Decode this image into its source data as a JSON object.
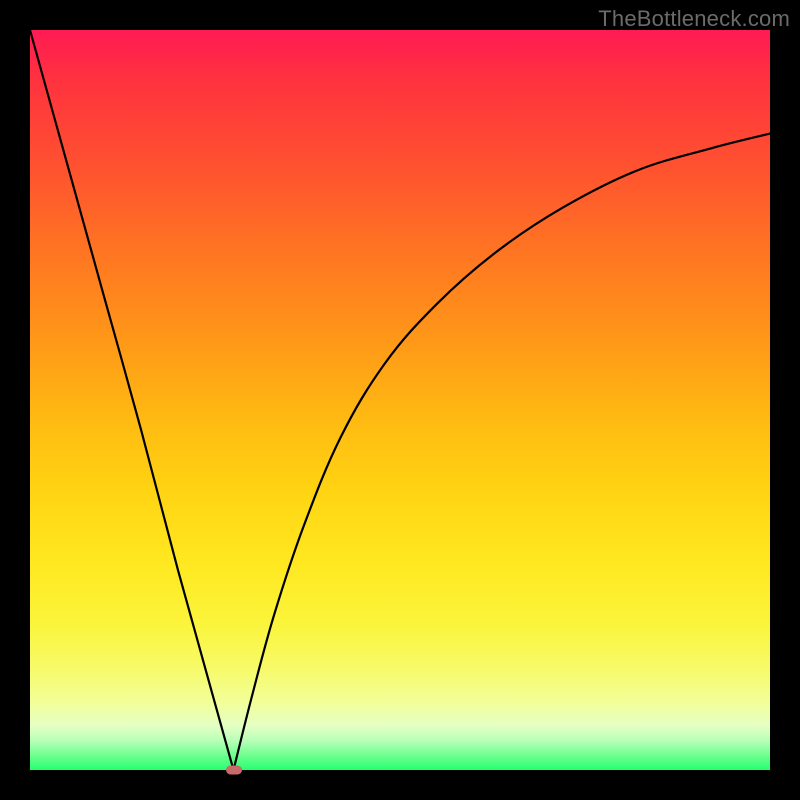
{
  "watermark": "TheBottleneck.com",
  "chart_data": {
    "type": "line",
    "title": "",
    "xlabel": "",
    "ylabel": "",
    "xlim": [
      0,
      100
    ],
    "ylim": [
      0,
      100
    ],
    "grid": false,
    "legend": false,
    "series": [
      {
        "name": "left-branch",
        "x": [
          0,
          5,
          10,
          15,
          20,
          25,
          27.5
        ],
        "values": [
          100,
          82,
          64,
          46,
          27,
          9,
          0
        ]
      },
      {
        "name": "right-branch",
        "x": [
          27.5,
          30,
          33,
          37,
          42,
          48,
          55,
          63,
          72,
          82,
          92,
          100
        ],
        "values": [
          0,
          10,
          21,
          33,
          45,
          55,
          63,
          70,
          76,
          81,
          84,
          86
        ]
      }
    ],
    "marker": {
      "x": 27.5,
      "y": 0,
      "color": "#c76a6a"
    },
    "gradient_stops": [
      {
        "pos": 0,
        "color": "#ff1a54"
      },
      {
        "pos": 50,
        "color": "#ffca12"
      },
      {
        "pos": 85,
        "color": "#f7fa66"
      },
      {
        "pos": 100,
        "color": "#25ff70"
      }
    ]
  }
}
